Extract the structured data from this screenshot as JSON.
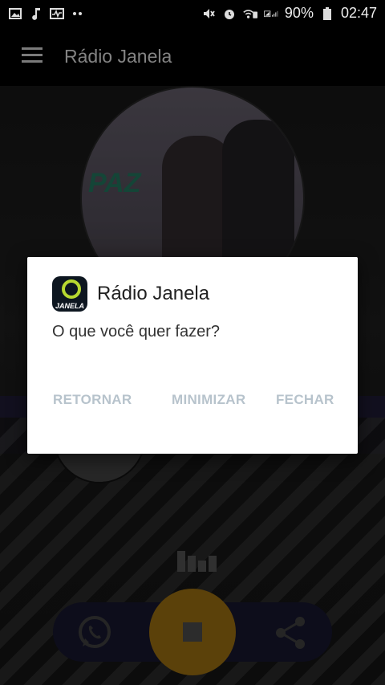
{
  "status_bar": {
    "left_icons": [
      "gallery-icon",
      "music-note-icon",
      "activity-icon",
      "more-dots-icon"
    ],
    "right_icons": [
      "mute-icon",
      "alarm-icon",
      "wifi-call-icon",
      "signal-icon"
    ],
    "battery": "90%",
    "time": "02:47"
  },
  "app_bar": {
    "menu_icon": "hamburger-menu-icon",
    "title": "Rádio Janela"
  },
  "now_playing": {
    "album_text": "PAZ"
  },
  "player": {
    "whatsapp_icon": "whatsapp-icon",
    "stop_icon": "stop-icon",
    "share_icon": "share-icon",
    "accent_color": "#e3a21a"
  },
  "dialog": {
    "app_name": "Rádio Janela",
    "icon_text": "JANELA",
    "message": "O que você quer fazer?",
    "buttons": {
      "back": "RETORNAR",
      "minimize": "MINIMIZAR",
      "close": "FECHAR"
    },
    "button_color": "#b7c3cc"
  }
}
